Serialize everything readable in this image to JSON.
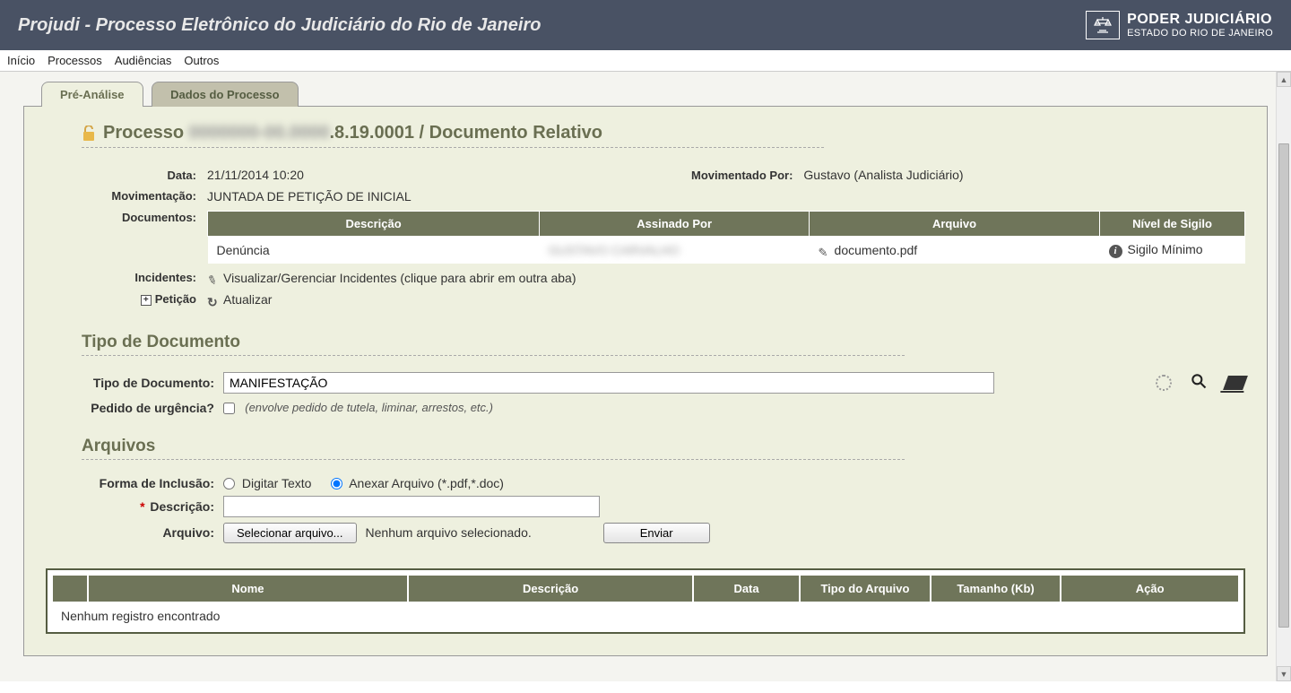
{
  "header": {
    "title": "Projudi - Processo Eletrônico do Judiciário do Rio de Janeiro",
    "org1": "PODER JUDICIÁRIO",
    "org2": "ESTADO DO RIO DE JANEIRO",
    "logo_label": "PJERJ"
  },
  "menu": {
    "inicio": "Início",
    "processos": "Processos",
    "audiencias": "Audiências",
    "outros": "Outros"
  },
  "tabs": {
    "pre": "Pré-Análise",
    "dados": "Dados do Processo"
  },
  "proc": {
    "prefix": "Processo ",
    "redacted_num": "0000000-00.0000",
    "suffix": ".8.19.0001 / Documento Relativo"
  },
  "fields": {
    "data_label": "Data:",
    "data_value": "21/11/2014 10:20",
    "movpor_label": "Movimentado Por:",
    "movpor_value": "Gustavo (Analista Judiciário)",
    "movim_label": "Movimentação:",
    "movim_value": "JUNTADA DE PETIÇÃO DE INICIAL",
    "documentos_label": "Documentos:",
    "incidentes_label": "Incidentes:",
    "incidentes_value": "Visualizar/Gerenciar Incidentes (clique para abrir em outra aba)",
    "peticao_label": "Petição",
    "atualizar": "Atualizar"
  },
  "doc_table": {
    "headers": {
      "desc": "Descrição",
      "assinado": "Assinado Por",
      "arquivo": "Arquivo",
      "sigilo": "Nível de Sigilo"
    },
    "row": {
      "desc": "Denúncia",
      "assinado": "GUSTAVO CARVALHO",
      "arquivo": "documento.pdf",
      "sigilo": "Sigilo Mínimo"
    }
  },
  "tipo_doc": {
    "header": "Tipo de Documento",
    "label": "Tipo de Documento:",
    "value": "MANIFESTAÇÃO",
    "urg_label": "Pedido de urgência?",
    "urg_note": "(envolve pedido de tutela, liminar, arrestos, etc.)"
  },
  "arquivos": {
    "header": "Arquivos",
    "forma_label": "Forma de Inclusão:",
    "radio_digitar": "Digitar Texto",
    "radio_anexar": "Anexar Arquivo (*.pdf,*.doc)",
    "desc_label": "Descrição:",
    "arq_label": "Arquivo:",
    "btn_selecionar": "Selecionar arquivo...",
    "file_note": "Nenhum arquivo selecionado.",
    "btn_enviar": "Enviar"
  },
  "files_table": {
    "headers": {
      "nome": "Nome",
      "desc": "Descrição",
      "data": "Data",
      "tipo": "Tipo do Arquivo",
      "tam": "Tamanho (Kb)",
      "acao": "Ação"
    },
    "empty": "Nenhum registro encontrado"
  }
}
